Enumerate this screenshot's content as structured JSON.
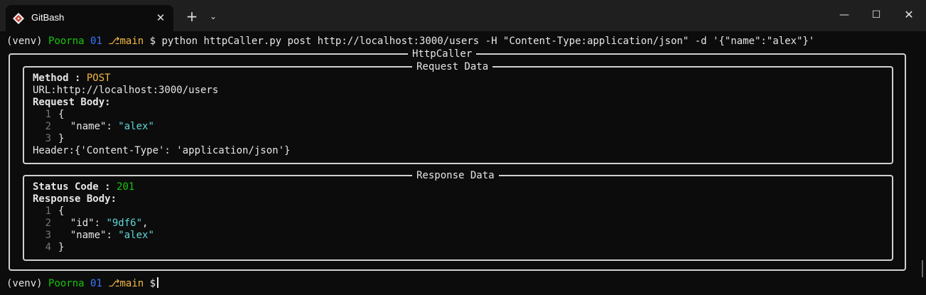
{
  "window": {
    "tab_title": "GitBash",
    "tab_close_glyph": "✕",
    "new_tab_glyph": "+",
    "dropdown_glyph": "⌄",
    "minimize_glyph": "—",
    "maximize_glyph": "☐",
    "close_glyph": "✕"
  },
  "prompt1": {
    "venv": "(venv)",
    "user": "Poorna",
    "num": "01",
    "branch_icon": "⎇",
    "branch": "main",
    "dollar": "$",
    "command": "python httpCaller.py post http://localhost:3000/users -H \"Content-Type:application/json\" -d '{\"name\":\"alex\"}'"
  },
  "outer_box": {
    "title": "HttpCaller"
  },
  "request": {
    "title": "Request Data",
    "method_label": "Method : ",
    "method_value": "POST",
    "url_line": "URL:http://localhost:3000/users",
    "body_label": "Request Body:",
    "body_lines": [
      {
        "num": "1",
        "text": "{"
      },
      {
        "num": "2",
        "key": "\"name\"",
        "sep": ": ",
        "value": "\"alex\""
      },
      {
        "num": "3",
        "text": "}"
      }
    ],
    "header_line": "Header:{'Content-Type': 'application/json'}"
  },
  "response": {
    "title": "Response Data",
    "status_label": "Status Code : ",
    "status_value": "201",
    "body_label": "Response Body:",
    "body_lines": [
      {
        "num": "1",
        "text": "{"
      },
      {
        "num": "2",
        "key": "\"id\"",
        "sep": ": ",
        "value": "\"9df6\"",
        "trail": ","
      },
      {
        "num": "3",
        "key": "\"name\"",
        "sep": ": ",
        "value": "\"alex\""
      },
      {
        "num": "4",
        "text": "}"
      }
    ]
  },
  "prompt2": {
    "venv": "(venv)",
    "user": "Poorna",
    "num": "01",
    "branch_icon": "⎇",
    "branch": "main",
    "dollar": "$"
  },
  "colors": {
    "titlebar": "#1f1f1f",
    "background": "#0c0c0c",
    "green": "#16c60c",
    "blue": "#3b78ff",
    "orange": "#f4b942",
    "cyan": "#61d6d6",
    "box_border": "#d0d0d0"
  },
  "icons": {
    "tab_icon": "git-diamond-icon"
  }
}
